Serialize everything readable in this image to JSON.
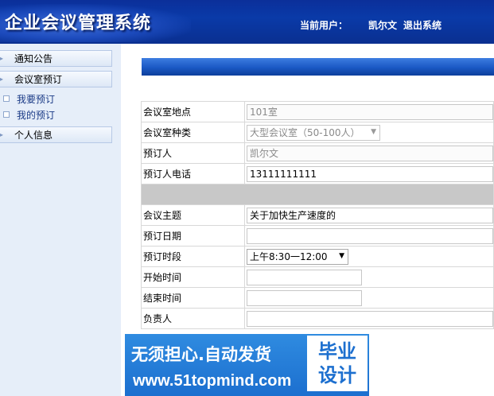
{
  "header": {
    "app_title": "企业会议管理系统",
    "current_user_label": "当前用户：",
    "user_name": "凯尔文",
    "logout": "退出系统"
  },
  "sidebar": {
    "items": [
      {
        "label": "通知公告"
      },
      {
        "label": "会议室预订"
      },
      {
        "label": "我要预订"
      },
      {
        "label": "我的预订"
      },
      {
        "label": "个人信息"
      }
    ]
  },
  "form": {
    "location_label": "会议室地点",
    "location_value": "101室",
    "type_label": "会议室种类",
    "type_value": "大型会议室（50-100人）",
    "booker_label": "预订人",
    "booker_value": "凯尔文",
    "phone_label": "预订人电话",
    "phone_value": "13111111111",
    "subject_label": "会议主题",
    "subject_value": "关于加快生产速度的",
    "date_label": "预订日期",
    "date_value": "",
    "period_label": "预订时段",
    "period_value": "上午8:30一12:00",
    "start_label": "开始时间",
    "start_value": "",
    "end_label": "结束时间",
    "end_value": "",
    "owner_label": "负责人",
    "owner_value": ""
  },
  "watermark": {
    "line1": "无须担心.自动发货",
    "line2": "www.51topmind.com",
    "box_top": "毕业",
    "box_bottom": "设计"
  },
  "colors": {
    "header_blue": "#0a2f90",
    "banner_blue": "#1a58c4",
    "sidebar_bg": "#e6eef9",
    "separator_gray": "#c8c8c8"
  }
}
